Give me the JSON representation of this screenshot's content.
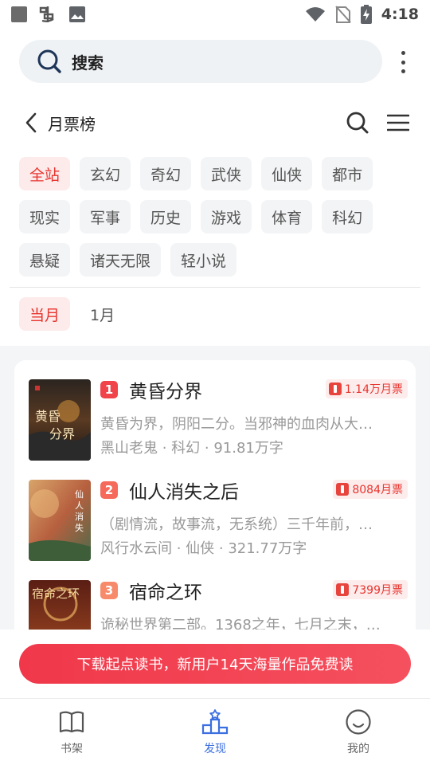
{
  "status_bar": {
    "time": "4:18",
    "left_icons": [
      "square-icon",
      "notification-icon",
      "image-icon"
    ],
    "right_icons": [
      "wifi-icon",
      "no-sim-icon",
      "battery-charging-icon"
    ]
  },
  "search": {
    "label": "搜索"
  },
  "header": {
    "title": "月票榜"
  },
  "categories": [
    {
      "label": "全站",
      "active": true
    },
    {
      "label": "玄幻"
    },
    {
      "label": "奇幻"
    },
    {
      "label": "武侠"
    },
    {
      "label": "仙侠"
    },
    {
      "label": "都市"
    },
    {
      "label": "现实"
    },
    {
      "label": "军事"
    },
    {
      "label": "历史"
    },
    {
      "label": "游戏"
    },
    {
      "label": "体育"
    },
    {
      "label": "科幻"
    },
    {
      "label": "悬疑"
    },
    {
      "label": "诸天无限"
    },
    {
      "label": "轻小说"
    }
  ],
  "periods": [
    {
      "label": "当月",
      "active": true
    },
    {
      "label": "1月"
    }
  ],
  "books": [
    {
      "rank": "1",
      "title": "黄昏分界",
      "votes": "1.14万月票",
      "synopsis": "黄昏为界，阴阳二分。当邪神的血肉从大…",
      "meta": "黑山老鬼 · 科幻 · 91.81万字",
      "cover_text": "黄昏分界",
      "rank_color": "#f0434a"
    },
    {
      "rank": "2",
      "title": "仙人消失之后",
      "votes": "8084月票",
      "synopsis": "（剧情流，故事流，无系统）三千年前，…",
      "meta": "风行水云间 · 仙侠 · 321.77万字",
      "cover_text": "仙人消失之后",
      "rank_color": "#f56a5a"
    },
    {
      "rank": "3",
      "title": "宿命之环",
      "votes": "7399月票",
      "synopsis": "诡秘世界第二部。1368之年，七月之末，…",
      "meta": "",
      "cover_text": "宿命之环",
      "rank_color": "#f78a6a"
    }
  ],
  "banner": {
    "text": "下载起点读书，新用户14天海量作品免费读"
  },
  "tabs": [
    {
      "label": "书架",
      "icon": "book-icon",
      "active": false
    },
    {
      "label": "发现",
      "icon": "podium-icon",
      "active": true
    },
    {
      "label": "我的",
      "icon": "smiley-icon",
      "active": false
    }
  ],
  "colors": {
    "accent_red": "#e8342e",
    "active_blue": "#3b6fe0",
    "chip_bg": "#f3f4f6"
  }
}
